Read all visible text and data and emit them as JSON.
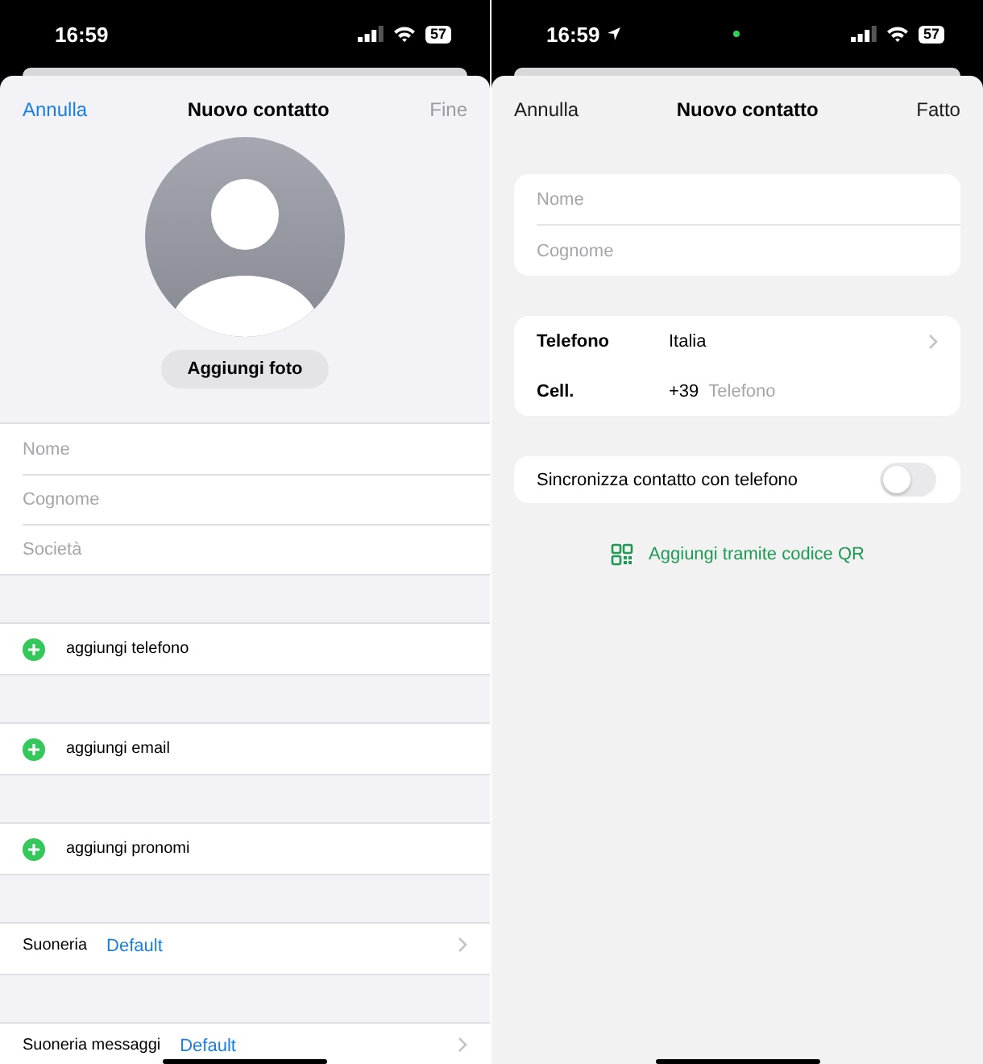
{
  "left": {
    "status_bar": {
      "time": "16:59",
      "battery": "57"
    },
    "nav": {
      "cancel": "Annulla",
      "title": "Nuovo contatto",
      "done": "Fine",
      "disabled": true
    },
    "photo_button": "Aggiungi foto",
    "name_fields": [
      {
        "placeholder": "Nome"
      },
      {
        "placeholder": "Cognome"
      },
      {
        "placeholder": "Società"
      }
    ],
    "add_rows": [
      {
        "label": "aggiungi telefono"
      },
      {
        "label": "aggiungi email"
      },
      {
        "label": "aggiungi pronomi"
      }
    ],
    "ringtone_rows": [
      {
        "label": "Suoneria",
        "value": "Default"
      },
      {
        "label": "Suoneria messaggi",
        "value": "Default"
      }
    ]
  },
  "right": {
    "status_bar": {
      "time": "16:59",
      "battery": "57",
      "location": true,
      "privacy_dot": true
    },
    "nav": {
      "cancel": "Annulla",
      "title": "Nuovo contatto",
      "done": "Fatto",
      "disabled": false
    },
    "name_fields": [
      {
        "placeholder": "Nome"
      },
      {
        "placeholder": "Cognome"
      }
    ],
    "phone_card": {
      "label": "Telefono",
      "country": "Italia",
      "type_label": "Cell.",
      "prefix": "+39",
      "placeholder": "Telefono"
    },
    "sync": {
      "label": "Sincronizza contatto con telefono",
      "on": false
    },
    "qr_link": "Aggiungi tramite codice QR"
  }
}
